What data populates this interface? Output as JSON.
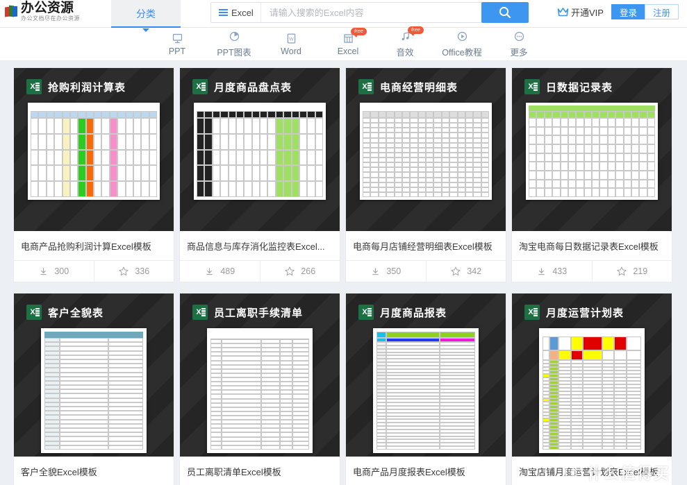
{
  "header": {
    "logo_title": "办公资源",
    "logo_sub": "办公文档尽在办公资源",
    "tab_label": "分类",
    "search": {
      "type_label": "Excel",
      "placeholder": "请输入搜索的Excel内容",
      "value": "",
      "button_icon": "search-icon"
    },
    "vip_label": "开通VIP",
    "login_label": "登录",
    "register_label": "注册"
  },
  "nav": {
    "items": [
      {
        "label": "PPT",
        "icon": "monitor-icon",
        "badge": ""
      },
      {
        "label": "PPT图表",
        "icon": "pie-chart-icon",
        "badge": ""
      },
      {
        "label": "Word",
        "icon": "word-doc-icon",
        "badge": ""
      },
      {
        "label": "Excel",
        "icon": "grid-table-icon",
        "badge": "free"
      },
      {
        "label": "音效",
        "icon": "music-note-icon",
        "badge": "free"
      },
      {
        "label": "Office教程",
        "icon": "play-circle-icon",
        "badge": ""
      },
      {
        "label": "更多",
        "icon": "ellipsis-circle-icon",
        "badge": ""
      }
    ]
  },
  "cards": [
    {
      "thumb_title": "抢购利润计算表",
      "title": "电商产品抢购利润计算Excel模板",
      "downloads": "300",
      "favorites": "336",
      "preview": "wide"
    },
    {
      "thumb_title": "月度商品盘点表",
      "title": "商品信息与库存消化监控表Excel...",
      "downloads": "489",
      "favorites": "266",
      "preview": "wide"
    },
    {
      "thumb_title": "电商经营明细表",
      "title": "电商每月店铺经营明细表Excel模板",
      "downloads": "350",
      "favorites": "342",
      "preview": "wide"
    },
    {
      "thumb_title": "日数据记录表",
      "title": "淘宝电商每日数据记录表Excel模板",
      "downloads": "433",
      "favorites": "219",
      "preview": "wide"
    },
    {
      "thumb_title": "客户全貌表",
      "title": "客户全貌Excel模板",
      "downloads": "",
      "favorites": "",
      "preview": "tall"
    },
    {
      "thumb_title": "员工离职手续清单",
      "title": "员工离职清单Excel模板",
      "downloads": "",
      "favorites": "",
      "preview": "tall"
    },
    {
      "thumb_title": "月度商品报表",
      "title": "电商产品月度报表Excel模板",
      "downloads": "",
      "favorites": "",
      "preview": "tall"
    },
    {
      "thumb_title": "月度运营计划表",
      "title": "淘宝店铺月度运营计划表Excel模板",
      "downloads": "",
      "favorites": "",
      "preview": "tall"
    }
  ],
  "watermark": {
    "text": "什么值得买",
    "mark": "值"
  },
  "colors": {
    "accent_blue": "#3d96f0",
    "badge_orange": "#f2593a",
    "excel_green": "#1d7044",
    "page_bg": "#eceff3",
    "thumb_bg": "#252525"
  }
}
